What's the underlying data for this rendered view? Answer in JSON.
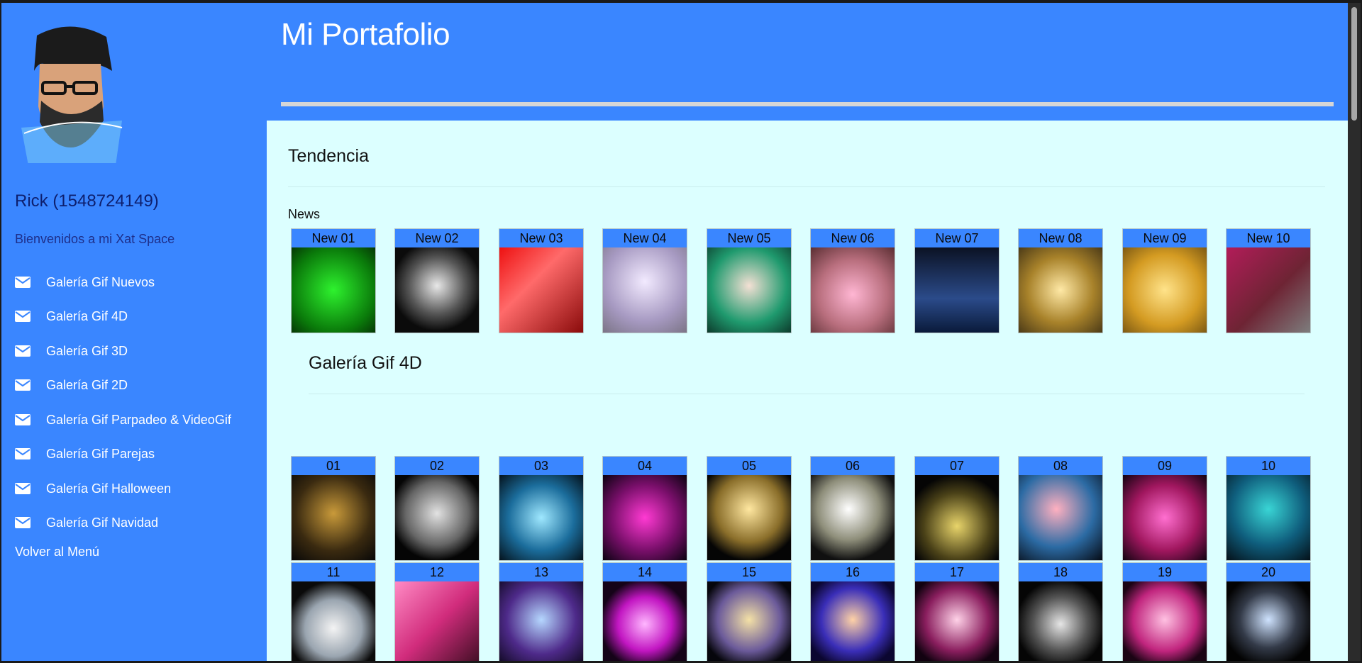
{
  "header": {
    "title": "Mi Portafolio"
  },
  "sidebar": {
    "user": "Rick (1548724149)",
    "welcome": "Bienvenidos a mi Xat Space",
    "items": [
      {
        "label": "Galería Gif Nuevos",
        "icon": "envelope-icon"
      },
      {
        "label": "Galería Gif 4D",
        "icon": "envelope-icon"
      },
      {
        "label": "Galería Gif 3D",
        "icon": "envelope-icon"
      },
      {
        "label": "Galería Gif 2D",
        "icon": "envelope-icon"
      },
      {
        "label": "Galería Gif Parpadeo & VideoGif",
        "icon": "envelope-icon"
      },
      {
        "label": "Galería Gif Parejas",
        "icon": "envelope-icon"
      },
      {
        "label": "Galería Gif Halloween",
        "icon": "envelope-icon"
      },
      {
        "label": "Galería Gif Navidad",
        "icon": "envelope-icon"
      }
    ],
    "back": "Volver al Menú"
  },
  "main": {
    "section_title": "Tendencia",
    "news_label": "News",
    "news": [
      "New 01",
      "New 02",
      "New 03",
      "New 04",
      "New 05",
      "New 06",
      "New 07",
      "New 08",
      "New 09",
      "New 10"
    ],
    "gallery_title": "Galería Gif 4D",
    "gallery_row1": [
      "01",
      "02",
      "03",
      "04",
      "05",
      "06",
      "07",
      "08",
      "09",
      "10"
    ],
    "gallery_row2": [
      "11",
      "12",
      "13",
      "14",
      "15",
      "16",
      "17",
      "18",
      "19",
      "20"
    ]
  },
  "colors": {
    "primary_blue": "#3a86ff",
    "content_bg": "#dcffff",
    "header_rule": "#d6d6d6"
  }
}
